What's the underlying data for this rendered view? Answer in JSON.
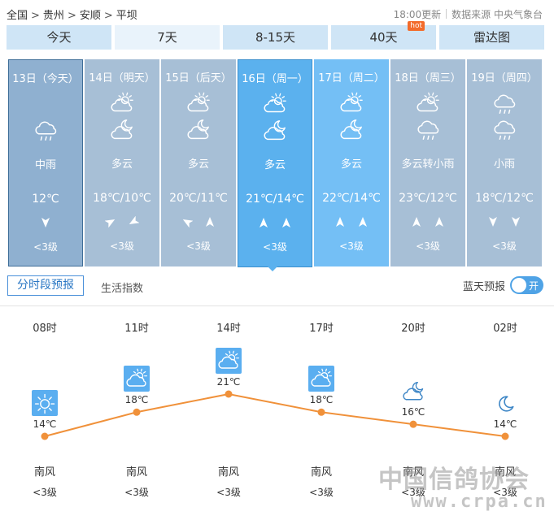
{
  "breadcrumb": [
    "全国",
    "贵州",
    "安顺",
    "平坝"
  ],
  "breadcrumb_sep": ">",
  "update": {
    "time": "18:00更新",
    "source": "数据来源 中央气象台"
  },
  "tabs": [
    {
      "label": "今天"
    },
    {
      "label": "7天"
    },
    {
      "label": "8-15天"
    },
    {
      "label": "40天",
      "badge": "hot"
    },
    {
      "label": "雷达图"
    }
  ],
  "days": [
    {
      "date": "13日（今天）",
      "icon1": "",
      "icon2": "cloud-rain-icon",
      "desc": "中雨",
      "temp": "12℃",
      "winds": [
        "down"
      ],
      "level": "<3级"
    },
    {
      "date": "14日（明天）",
      "icon1": "partly-cloudy-day-icon",
      "icon2": "partly-cloudy-night-icon",
      "desc": "多云",
      "temp": "18℃/10℃",
      "winds": [
        "right",
        "left-down"
      ],
      "level": "<3级"
    },
    {
      "date": "15日（后天）",
      "icon1": "partly-cloudy-day-icon",
      "icon2": "partly-cloudy-night-icon",
      "desc": "多云",
      "temp": "20℃/11℃",
      "winds": [
        "left-up",
        "up"
      ],
      "level": "<3级"
    },
    {
      "date": "16日（周一）",
      "icon1": "partly-cloudy-day-icon",
      "icon2": "partly-cloudy-night-icon",
      "desc": "多云",
      "temp": "21℃/14℃",
      "winds": [
        "up",
        "up"
      ],
      "level": "<3级"
    },
    {
      "date": "17日（周二）",
      "icon1": "partly-cloudy-day-icon",
      "icon2": "partly-cloudy-night-icon",
      "desc": "多云",
      "temp": "22℃/14℃",
      "winds": [
        "up",
        "up"
      ],
      "level": "<3级"
    },
    {
      "date": "18日（周三）",
      "icon1": "partly-cloudy-day-icon",
      "icon2": "cloud-rain-icon",
      "desc": "多云转小雨",
      "temp": "23℃/12℃",
      "winds": [
        "up",
        "up"
      ],
      "level": "<3级"
    },
    {
      "date": "19日（周四）",
      "icon1": "cloud-rain-icon",
      "icon2": "cloud-rain-icon",
      "desc": "小雨",
      "temp": "18℃/12℃",
      "winds": [
        "down",
        "down"
      ],
      "level": "<3级"
    }
  ],
  "subtabs": {
    "hourly": "分时段预报",
    "life": "生活指数"
  },
  "blue_sky": {
    "label": "蓝天预报",
    "toggle": "开"
  },
  "hourly": [
    {
      "time": "08时",
      "temp": "14℃",
      "temp_value": 14,
      "icon": "sun-icon",
      "wind": "南风",
      "level": "<3级"
    },
    {
      "time": "11时",
      "temp": "18℃",
      "temp_value": 18,
      "icon": "partly-cloudy-day-icon",
      "wind": "南风",
      "level": "<3级"
    },
    {
      "time": "14时",
      "temp": "21℃",
      "temp_value": 21,
      "icon": "partly-cloudy-day-icon",
      "wind": "南风",
      "level": "<3级"
    },
    {
      "time": "17时",
      "temp": "18℃",
      "temp_value": 18,
      "icon": "partly-cloudy-day-icon",
      "wind": "南风",
      "level": "<3级"
    },
    {
      "time": "20时",
      "temp": "16℃",
      "temp_value": 16,
      "icon": "partly-cloudy-night-icon",
      "wind": "南风",
      "level": "<3级"
    },
    {
      "time": "02时",
      "temp": "14℃",
      "temp_value": 14,
      "icon": "moon-icon",
      "wind": "南风",
      "level": "<3级"
    }
  ],
  "watermark": {
    "line1": "中国信鸽协会",
    "line2": "www.crpa.cn"
  },
  "colors": {
    "tab": "#cfe5f6",
    "card": "#a7bfd6",
    "card_selected": "#5bb1ee",
    "curve": "#f0913a",
    "accent": "#4fa3e6"
  }
}
